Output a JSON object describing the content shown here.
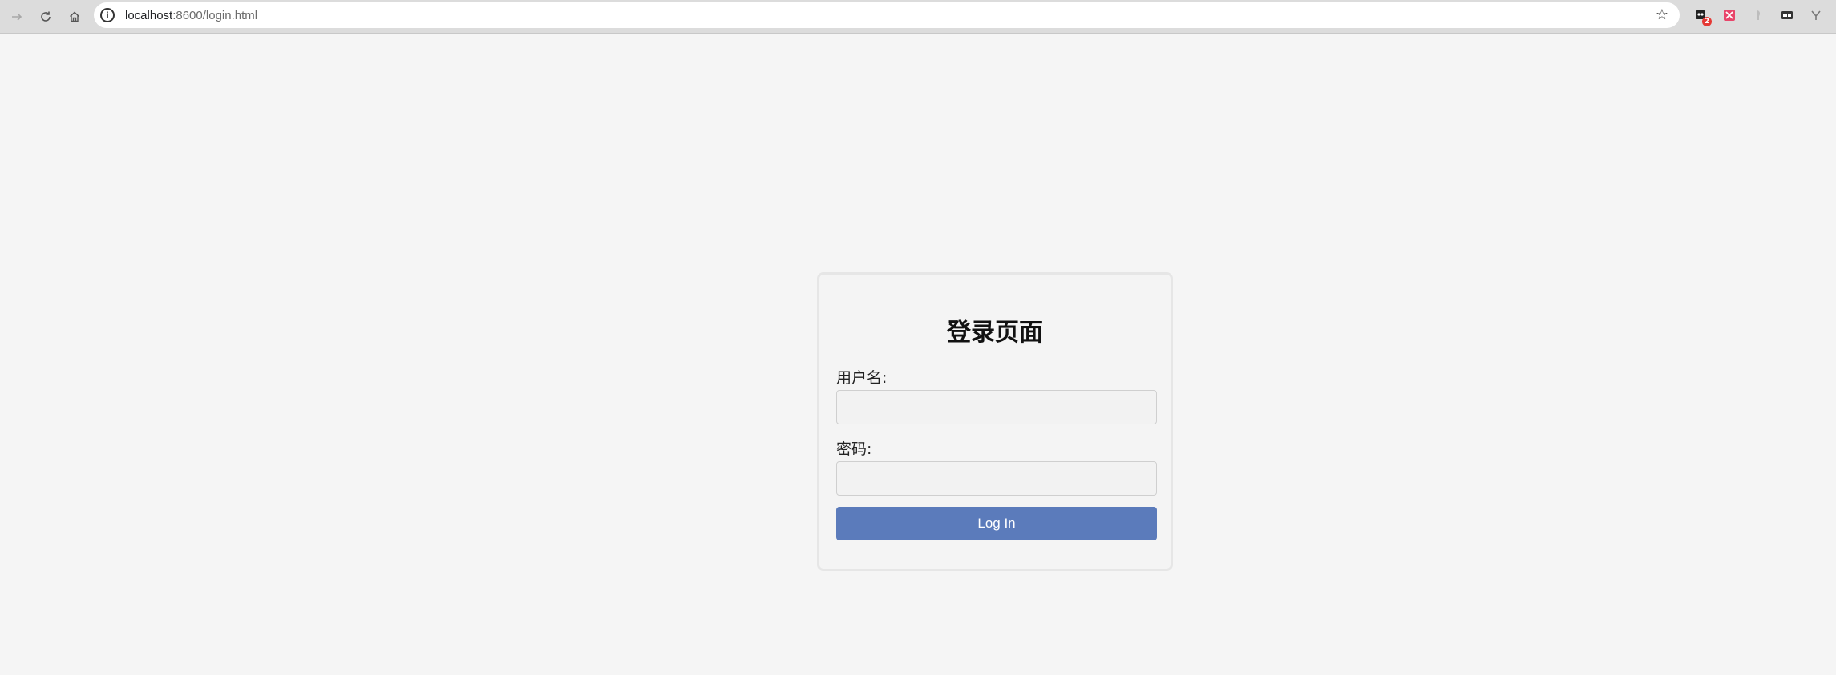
{
  "browser": {
    "url_host": "localhost",
    "url_rest": ":8600/login.html",
    "site_info_glyph": "i",
    "extensions": [
      {
        "icon": "extension-1-icon",
        "badge": "2"
      },
      {
        "icon": "extension-2-icon"
      },
      {
        "icon": "extension-3-icon"
      },
      {
        "icon": "extension-4-icon"
      },
      {
        "icon": "extension-5-icon"
      }
    ]
  },
  "login": {
    "title": "登录页面",
    "username_label": "用户名:",
    "username_value": "",
    "password_label": "密码:",
    "password_value": "",
    "submit_label": "Log In"
  },
  "colors": {
    "page_bg": "#f5f5f5",
    "button_bg": "#5b7bbb",
    "button_text": "#ffffff"
  }
}
